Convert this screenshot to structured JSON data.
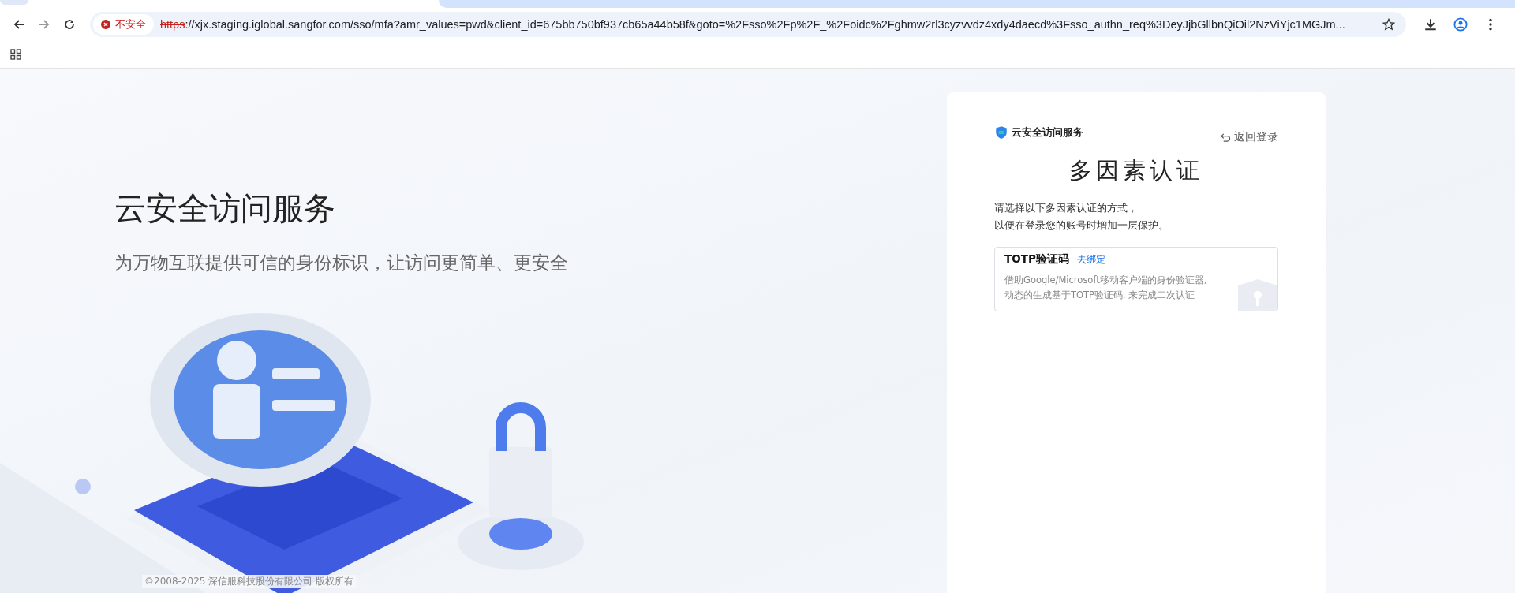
{
  "browser": {
    "security_label": "不安全",
    "url_scheme": "https",
    "url_rest": "://xjx.staging.iglobal.sangfor.com/sso/mfa?amr_values=pwd&client_id=675bb750bf937cb65a44b58f&goto=%2Fsso%2Fp%2F_%2Foidc%2Fghmw2rl3cyzvvdz4xdy4daecd%3Fsso_authn_req%3DeyJjbGllbnQiOil2NzViYjc1MGJm..."
  },
  "hero": {
    "title": "云安全访问服务",
    "subtitle": "为万物互联提供可信的身份标识，让访问更简单、更安全",
    "kind": "picture"
  },
  "footer": {
    "copyright": "©2008-2025 深信服科技股份有限公司 版权所有"
  },
  "card": {
    "brand": "云安全访问服务",
    "back_link": "返回登录",
    "title": "多因素认证",
    "intro": [
      "请选择以下多因素认证的方式，",
      "以便在登录您的账号时增加一层保护。"
    ],
    "methods": [
      {
        "name": "TOTP验证码",
        "action": "去绑定",
        "description": [
          "借助Google/Microsoft移动客户端的身份验证器,",
          "动态的生成基于TOTP验证码, 来完成二次认证"
        ]
      }
    ]
  }
}
